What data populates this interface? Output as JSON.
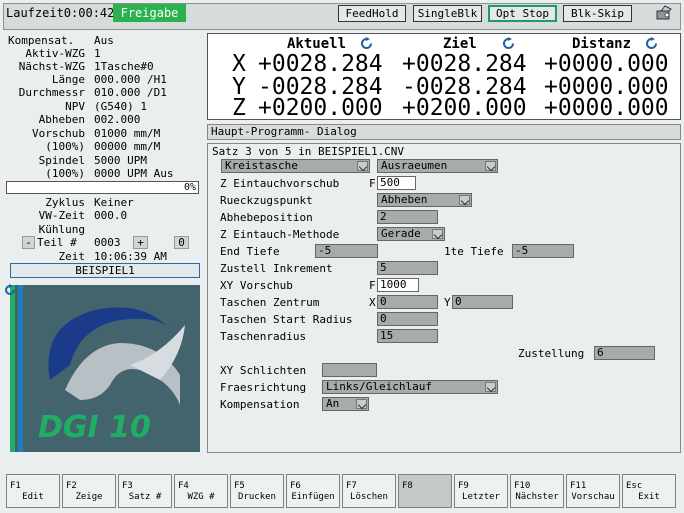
{
  "topbar": {
    "runtime": "Laufzeit0:00:42",
    "status_badge": "Freigabe",
    "buttons": [
      {
        "label": "FeedHold",
        "active": false
      },
      {
        "label": "SingleBlk",
        "active": false
      },
      {
        "label": "Opt Stop",
        "active": true
      },
      {
        "label": "Blk-Skip",
        "active": false
      }
    ]
  },
  "left": {
    "rows": [
      {
        "label": "Kompensat.",
        "value": "Aus"
      },
      {
        "label": "Aktiv-WZG",
        "value": "1"
      },
      {
        "label": "Nächst-WZG",
        "value": "1Tasche#0"
      },
      {
        "label": "Länge",
        "value": "000.000 /H1"
      },
      {
        "label": "Durchmessr",
        "value": "010.000 /D1"
      },
      {
        "label": "NPV",
        "value": "(G540) 1"
      },
      {
        "label": "Abheben",
        "value": "002.000"
      },
      {
        "label": "Vorschub",
        "value": "01000 mm/M"
      },
      {
        "label": "(100%)",
        "value": "00000 mm/M"
      },
      {
        "label": "Spindel",
        "value": "5000 UPM"
      },
      {
        "label": "(100%)",
        "value": "0000 UPM Aus"
      }
    ],
    "progress": "0%",
    "zyklus_label": "Zyklus",
    "zyklus_value": "Keiner",
    "vwzeit_label": "VW-Zeit",
    "vwzeit_value": "000.0",
    "kuehlung_label": "Kühlung",
    "teil_minus": "-",
    "teil_label": "Teil #",
    "teil_value": "0003",
    "teil_plus": "+",
    "teil_reset": "0",
    "zeit_label": "Zeit",
    "zeit_value": "10:06:39 AM",
    "program_name": "BEISPIEL1",
    "logo_text": "DGI 10"
  },
  "coords": {
    "headers": [
      "Aktuell",
      "Ziel",
      "Distanz"
    ],
    "rows": [
      {
        "axis": "X",
        "aktuell": "+0028.284",
        "ziel": "+0028.284",
        "distanz": "+0000.000"
      },
      {
        "axis": "Y",
        "aktuell": "-0028.284",
        "ziel": "-0028.284",
        "distanz": "+0000.000"
      },
      {
        "axis": "Z",
        "aktuell": "+0200.000",
        "ziel": "+0200.000",
        "distanz": "+0000.000"
      }
    ]
  },
  "program_bar": {
    "label": "Haupt-Programm-  Dialog"
  },
  "dialog": {
    "satz": "Satz 3 von 5 in BEISPIEL1.CNV",
    "type_select": "Kreistasche",
    "mode_select": "Ausraeumen",
    "z_eintauchvorschub_label": "Z Eintauchvorschub",
    "z_eintauchvorschub_prefix": "F",
    "z_eintauchvorschub": "500",
    "rueckzugspunkt_label": "Rueckzugspunkt",
    "rueckzugspunkt": "Abheben",
    "abhebeposition_label": "Abhebeposition",
    "abhebeposition": "2",
    "z_eintauch_methode_label": "Z Eintauch-Methode",
    "z_eintauch_methode": "Gerade",
    "end_tiefe_label": "End Tiefe",
    "end_tiefe": "-5",
    "erste_tiefe_label": "1te Tiefe",
    "erste_tiefe": "-5",
    "zustell_inkrement_label": "Zustell Inkrement",
    "zustell_inkrement": "5",
    "xy_vorschub_label": "XY Vorschub",
    "xy_vorschub_prefix": "F",
    "xy_vorschub": "1000",
    "taschen_zentrum_label": "Taschen Zentrum",
    "taschen_x_prefix": "X",
    "taschen_x": "0",
    "taschen_y_prefix": "Y",
    "taschen_y": "0",
    "taschen_start_radius_label": "Taschen Start Radius",
    "taschen_start_radius": "0",
    "taschenradius_label": "Taschenradius",
    "taschenradius": "15",
    "zustellung_label": "Zustellung",
    "zustellung": "6",
    "xy_schlichten_label": "XY Schlichten",
    "xy_schlichten": "",
    "fraesrichtung_label": "Fraesrichtung",
    "fraesrichtung": "Links/Gleichlauf",
    "kompensation_label": "Kompensation",
    "kompensation": "An"
  },
  "fkeys": [
    {
      "key": "F1",
      "label": "Edit"
    },
    {
      "key": "F2",
      "label": "Zeige"
    },
    {
      "key": "F3",
      "label": "Satz #"
    },
    {
      "key": "F4",
      "label": "WZG #"
    },
    {
      "key": "F5",
      "label": "Drucken"
    },
    {
      "key": "F6",
      "label": "Einfügen"
    },
    {
      "key": "F7",
      "label": "Löschen"
    },
    {
      "key": "F8",
      "label": ""
    },
    {
      "key": "F9",
      "label": "Letzter"
    },
    {
      "key": "F10",
      "label": "Nächster"
    },
    {
      "key": "F11",
      "label": "Vorschau"
    },
    {
      "key": "Esc",
      "label": "Exit"
    }
  ],
  "colors": {
    "accent_green": "#2bb24e",
    "active_border": "#1d9a66",
    "logo_bg": "#43636d",
    "logo_text": "#1fae63"
  }
}
